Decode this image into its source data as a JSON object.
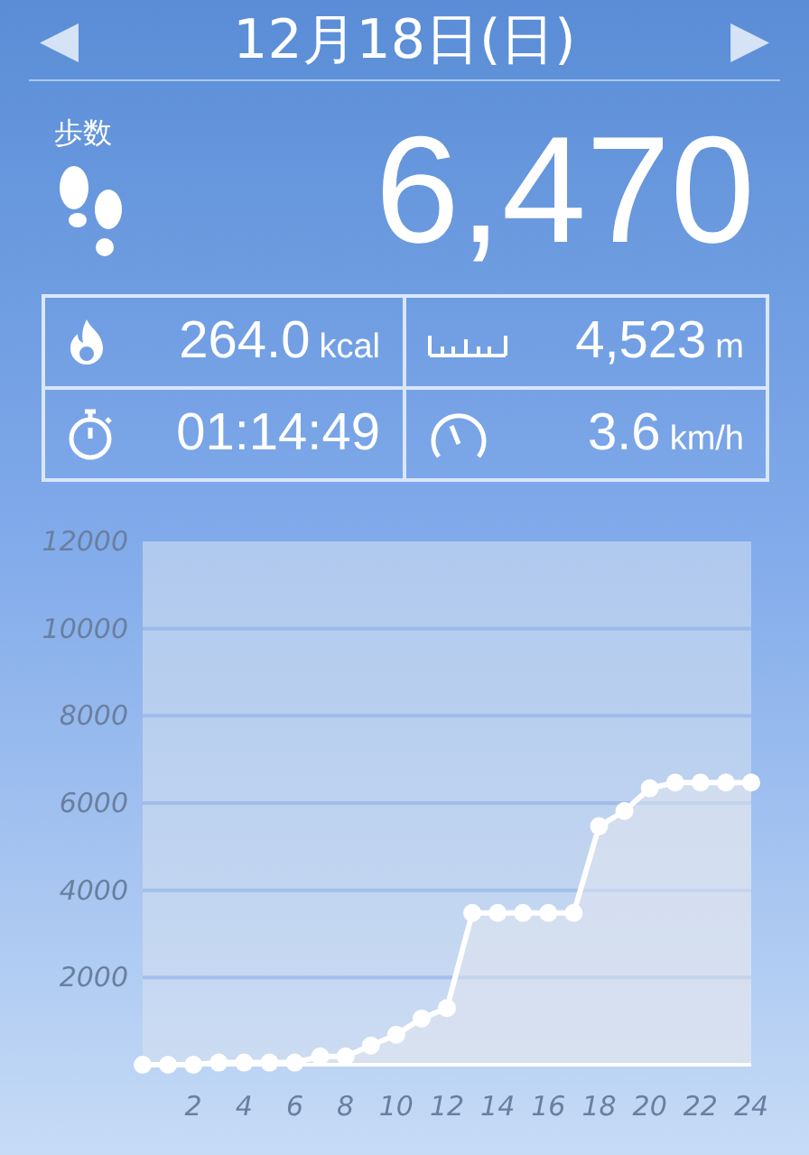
{
  "header": {
    "prev": "◀",
    "title": "12月18日(日)",
    "next": "▶"
  },
  "steps": {
    "label": "歩数",
    "value": "6,470"
  },
  "stats": [
    {
      "kind": "calories",
      "value": "264.0",
      "unit": "kcal"
    },
    {
      "kind": "distance",
      "value": "4,523",
      "unit": "m"
    },
    {
      "kind": "time",
      "value": "01:14:49"
    },
    {
      "kind": "speed",
      "value": "3.6",
      "unit": "km/h"
    }
  ],
  "chart": {
    "chart_data": {
      "type": "area",
      "x": [
        0,
        1,
        2,
        3,
        4,
        5,
        6,
        7,
        8,
        9,
        10,
        11,
        12,
        13,
        14,
        15,
        16,
        17,
        18,
        19,
        20,
        21,
        22,
        23,
        24
      ],
      "grid": true,
      "series": [
        {
          "color": "#ffffff",
          "values": [
            0,
            0,
            0,
            50,
            50,
            50,
            50,
            190,
            190,
            440,
            690,
            1060,
            1300,
            3480,
            3480,
            3480,
            3480,
            3480,
            5470,
            5820,
            6340,
            6470,
            6470,
            6470,
            6470
          ]
        }
      ],
      "xlim": [
        0,
        24
      ],
      "ylim": [
        0,
        12000
      ],
      "xticks": [
        2,
        4,
        6,
        8,
        10,
        12,
        14,
        16,
        18,
        20,
        22,
        24
      ],
      "yticks": [
        2000,
        4000,
        6000,
        8000,
        10000,
        12000
      ]
    }
  }
}
